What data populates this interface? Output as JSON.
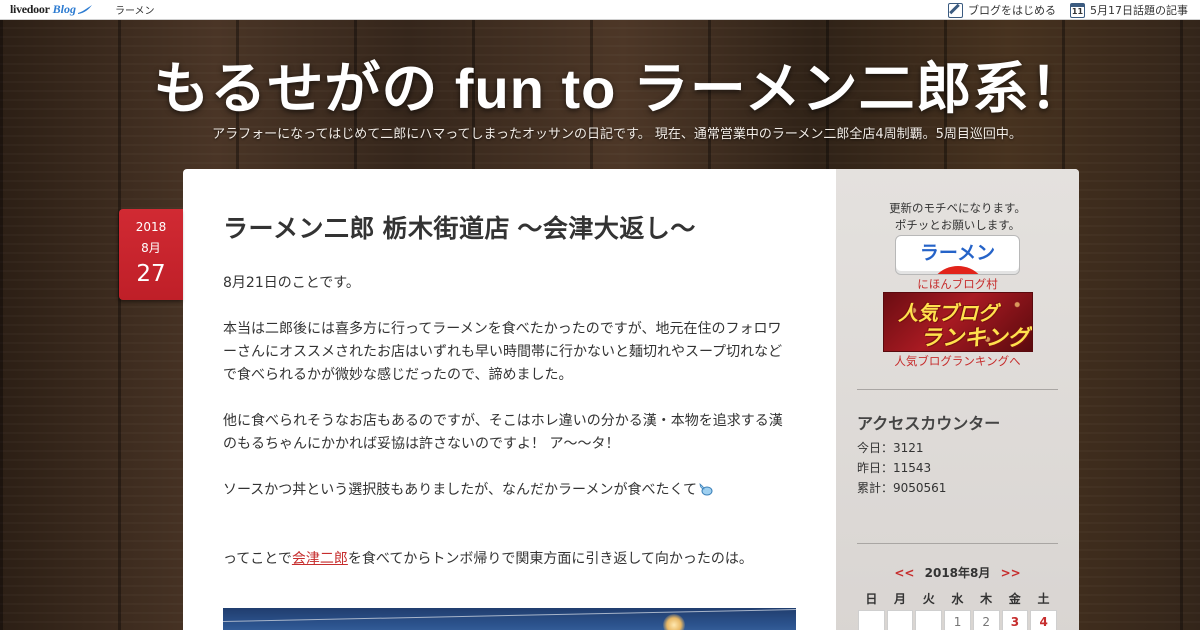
{
  "topbar": {
    "logo_text": "livedoor",
    "logo_blog": "Blog",
    "category": "ラーメン",
    "start_blog": "ブログをはじめる",
    "calendar_icon_day": "11",
    "trending": "5月17日話題の記事"
  },
  "header": {
    "title": "もるせがの fun to ラーメン二郎系！",
    "description": "アラフォーになってはじめて二郎にハマってしまったオッサンの日記です。 現在、通常営業中のラーメン二郎全店4周制覇。5周目巡回中。"
  },
  "article": {
    "date": {
      "year": "2018",
      "month": "8月",
      "day": "27"
    },
    "title": "ラーメン二郎 栃木街道店 〜会津大返し〜",
    "p1": "8月21日のことです。",
    "p2_line1": "本当は二郎後には喜多方に行ってラーメンを食べたかったのですが、地元在住のフォロワ",
    "p2_line2": "ーさんにオススメされたお店はいずれも早い時間帯に行かないと麺切れやスープ切れなど",
    "p2_line3": "で食べられるかが微妙な感じだったので、諦めました。",
    "p3_line1": "他に食べられそうなお店もあるのですが、そこはホレ違いの分かる漢・本物を追求する漢",
    "p3_line2": "のもるちゃんにかかれば妥協は許さないのですよ！ ア〜〜タ！",
    "p4": "ソースかつ丼という選択肢もありましたが、なんだかラーメンが食べたくて",
    "p5_before": "ってことで",
    "p5_link": "会津二郎",
    "p5_after": "を食べてからトンボ帰りで関東方面に引き返して向かったのは。"
  },
  "sidebar": {
    "cheer_line1": "更新のモチベになります。",
    "cheer_line2": "ポチッとお願いします。",
    "ramen_button": "ラーメン",
    "nihon_link": "にほんブログ村",
    "rank_banner_line1": "人気ブログ",
    "rank_banner_line2": "ランキング",
    "rank_link": "人気ブログランキングへ",
    "counter_heading": "アクセスカウンター",
    "today": "今日：3121",
    "yesterday": "昨日：11543",
    "total": "累計：9050561"
  },
  "calendar": {
    "prev": "<<",
    "month": "2018年8月",
    "next": ">>",
    "weekdays": [
      "日",
      "月",
      "火",
      "水",
      "木",
      "金",
      "土"
    ],
    "days": [
      "",
      "",
      "",
      "1",
      "2",
      "3",
      "4"
    ],
    "red_days": [
      "3",
      "4"
    ]
  },
  "colors": {
    "accent_red": "#c62d2d",
    "date_badge": "#d12a33",
    "link_blue": "#2563c8"
  }
}
